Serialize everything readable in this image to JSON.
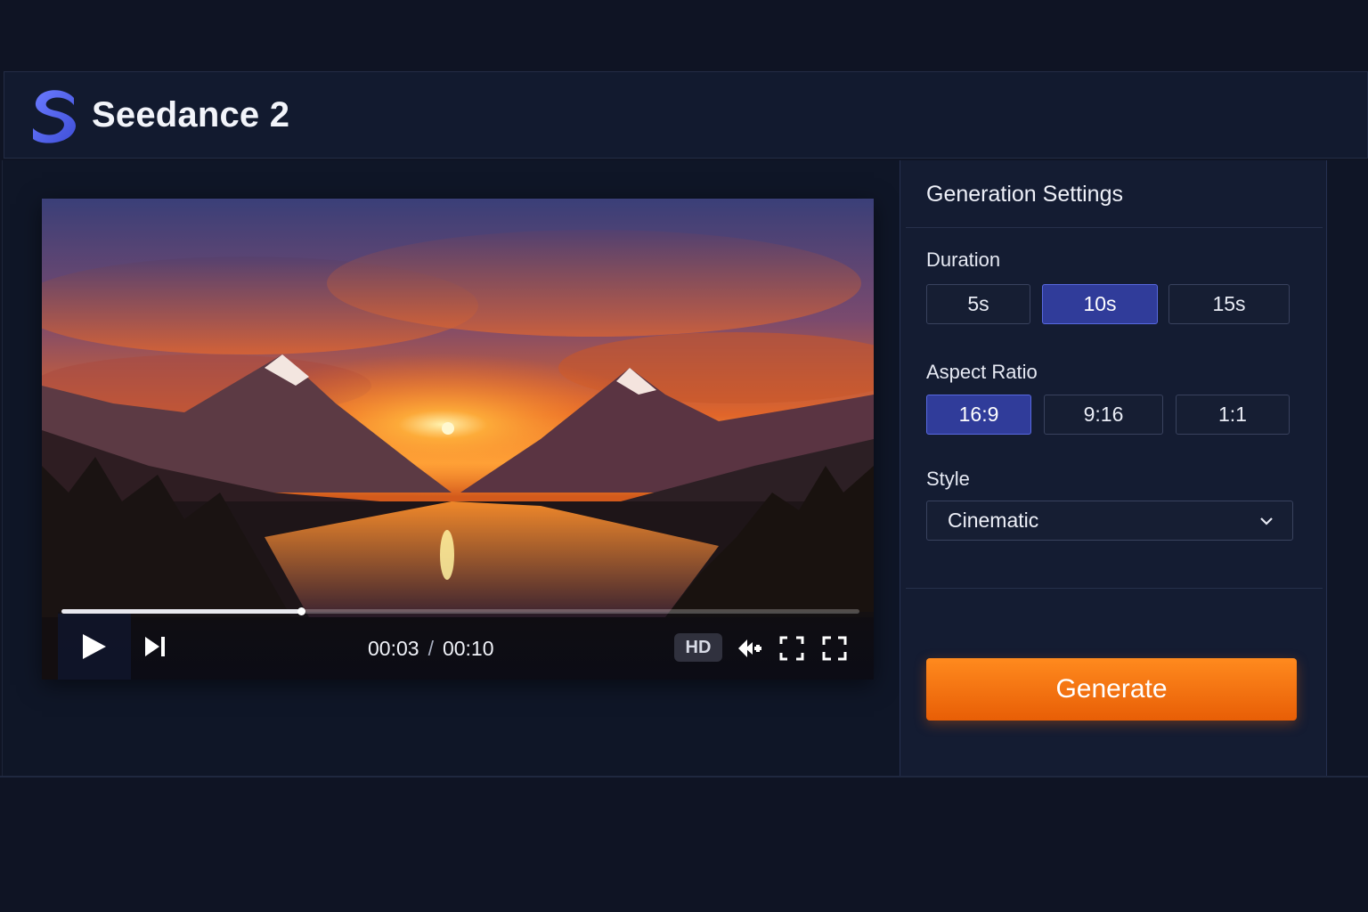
{
  "app": {
    "title": "Seedance 2",
    "brand_color": "#4f5fe8",
    "logo_icon": "seedance-s-logo"
  },
  "player": {
    "current_time": "00:03",
    "separator": "/",
    "duration": "00:10",
    "progress": 0.3,
    "quality_badge": "HD",
    "icons": [
      "play-icon",
      "skip-next-icon",
      "rewind-icon",
      "pip-icon",
      "fullscreen-icon"
    ]
  },
  "settings": {
    "title": "Generation Settings",
    "duration": {
      "label": "Duration",
      "options": [
        "5s",
        "10s",
        "15s"
      ],
      "selected": "10s"
    },
    "aspect_ratio": {
      "label": "Aspect Ratio",
      "options": [
        "16:9",
        "9:16",
        "1:1"
      ],
      "selected": "16:9"
    },
    "style": {
      "label": "Style",
      "value": "Cinematic"
    },
    "generate_label": "Generate",
    "accent_color": "#303c9a",
    "generate_color": "#f5730f"
  }
}
